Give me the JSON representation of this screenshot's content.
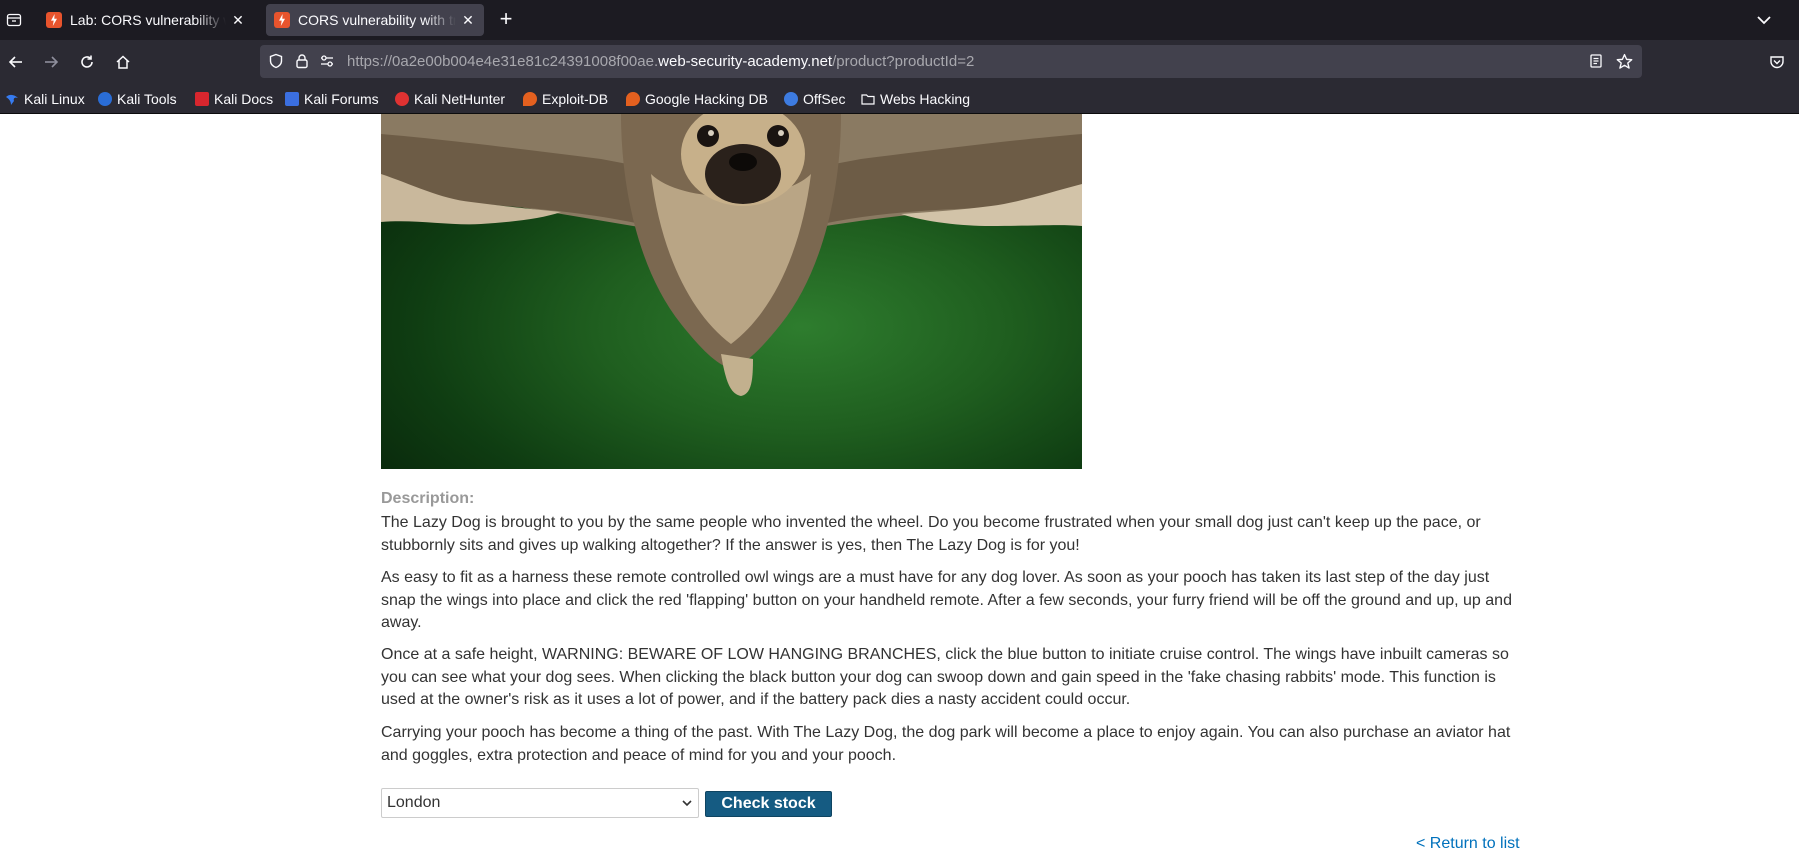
{
  "browser": {
    "tabs": [
      {
        "title": "Lab: CORS vulnerability with trusted null origin",
        "active": false
      },
      {
        "title": "CORS vulnerability with trusted null origin",
        "active": true
      }
    ],
    "url": {
      "prefix": "https://0a2e00b004e4e31e81c24391008f00ae.",
      "domain": "web-security-academy.net",
      "path": "/product?productId=2"
    },
    "bookmarks": [
      {
        "label": "Kali Linux",
        "icon": "kali-dragon-icon",
        "color": "#367bf0"
      },
      {
        "label": "Kali Tools",
        "icon": "kali-tools-icon",
        "color": "#2a6dd6"
      },
      {
        "label": "Kali Docs",
        "icon": "kali-docs-icon",
        "color": "#d8262e"
      },
      {
        "label": "Kali Forums",
        "icon": "kali-forums-icon",
        "color": "#3b6fe0"
      },
      {
        "label": "Kali NetHunter",
        "icon": "nethunter-icon",
        "color": "#e03232"
      },
      {
        "label": "Exploit-DB",
        "icon": "exploit-db-icon",
        "color": "#e4601f"
      },
      {
        "label": "Google Hacking DB",
        "icon": "ghdb-icon",
        "color": "#e4601f"
      },
      {
        "label": "OffSec",
        "icon": "offsec-icon",
        "color": "#3d7be0"
      },
      {
        "label": "Webs Hacking",
        "icon": "folder-icon",
        "color": "#fbfbfe"
      }
    ]
  },
  "product": {
    "description_label": "Description:",
    "paragraphs": [
      "The Lazy Dog is brought to you by the same people who invented the wheel. Do you become frustrated when your small dog just can't keep up the pace, or stubbornly sits and gives up walking altogether? If the answer is yes, then The Lazy Dog is for you!",
      "As easy to fit as a harness these remote controlled owl wings are a must have for any dog lover. As soon as your pooch has taken its last step of the day just snap the wings into place and click the red 'flapping' button on your handheld remote. After a few seconds, your furry friend will be off the ground and up, up and away.",
      "Once at a safe height, WARNING: BEWARE OF LOW HANGING BRANCHES, click the blue button to initiate cruise control. The wings have inbuilt cameras so you can see what your dog sees. When clicking the black button your dog can swoop down and gain speed in the 'fake chasing rabbits' mode. This function is used at the owner's risk as it uses a lot of power, and if the battery pack dies a nasty accident could occur.",
      "Carrying your pooch has become a thing of the past. With The Lazy Dog, the dog park will become a place to enjoy again. You can also purchase an aviator hat and goggles, extra protection and peace of mind for you and your pooch."
    ],
    "stock_location": "London",
    "check_stock_label": "Check stock",
    "return_link": "< Return to list"
  },
  "colors": {
    "tabbar_bg": "#1c1b22",
    "toolbar_bg": "#2b2a33",
    "button_blue": "#155b82",
    "link_blue": "#0071bc"
  }
}
